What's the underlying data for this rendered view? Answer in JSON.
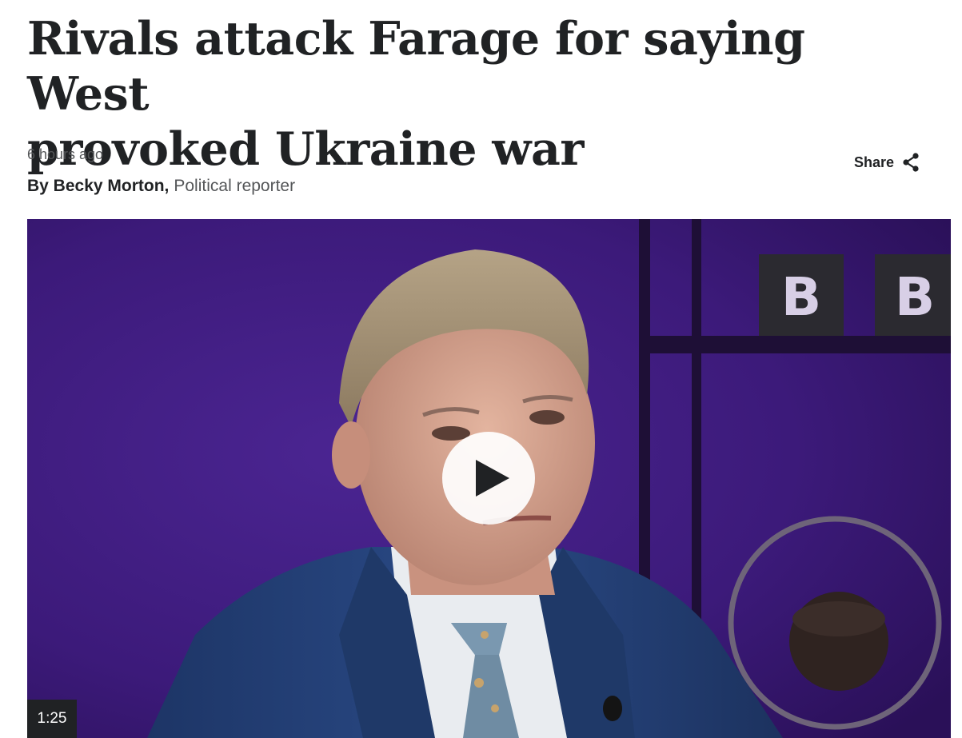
{
  "article": {
    "headline_line1": "Rivals attack Farage for saying West",
    "headline_line2": "provoked Ukraine war",
    "timestamp": "6 hours ago",
    "byline": {
      "prefix_author": "By Becky Morton,",
      "role": "Political reporter"
    }
  },
  "share": {
    "label": "Share",
    "icon": "share-icon"
  },
  "video": {
    "duration": "1:25",
    "play_icon": "play-icon",
    "backdrop_logo_letters": [
      "B",
      "B"
    ]
  },
  "colors": {
    "text": "#202224",
    "muted_text": "#545658",
    "backdrop": "#3a1872"
  }
}
